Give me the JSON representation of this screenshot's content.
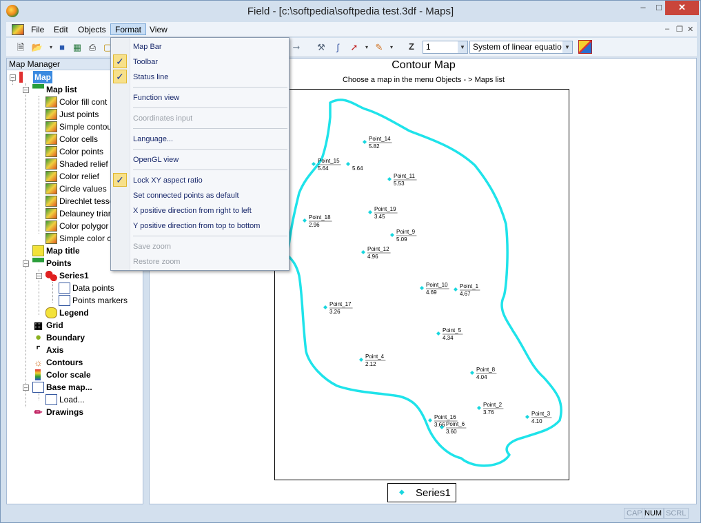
{
  "window": {
    "title": "Field - [c:\\softpedia\\softpedia test.3df - Maps]",
    "min_glyph": "–",
    "max_glyph": "□",
    "close_glyph": "✕"
  },
  "menubar": {
    "items": [
      "File",
      "Edit",
      "Objects",
      "Format",
      "View"
    ],
    "active": "Format",
    "mdi_min": "–",
    "mdi_restore": "❐",
    "mdi_close": "✕"
  },
  "toolbar": {
    "z_label": "Z",
    "z_value": "1",
    "solver_value": "System of linear equatio"
  },
  "format_menu": {
    "items": [
      {
        "label": "Map Bar",
        "checked": false,
        "disabled": false
      },
      {
        "label": "Toolbar",
        "checked": true,
        "disabled": false
      },
      {
        "label": "Status line",
        "checked": true,
        "disabled": false
      },
      {
        "label": "Function view",
        "checked": false,
        "disabled": false
      },
      {
        "label": "Coordinates input",
        "checked": false,
        "disabled": true
      },
      {
        "label": "Language...",
        "checked": false,
        "disabled": false
      },
      {
        "label": "OpenGL view",
        "checked": false,
        "disabled": false
      },
      {
        "label": "Lock XY aspect ratio",
        "checked": true,
        "disabled": false
      },
      {
        "label": "Set connected points as default",
        "checked": false,
        "disabled": false
      },
      {
        "label": "X positive direction from right to left",
        "checked": false,
        "disabled": false
      },
      {
        "label": "Y positive direction from top to bottom",
        "checked": false,
        "disabled": false
      },
      {
        "label": "Save zoom",
        "checked": false,
        "disabled": true
      },
      {
        "label": "Restore zoom",
        "checked": false,
        "disabled": true
      }
    ],
    "check_glyph": "✓"
  },
  "map_manager": {
    "header": "Map Manager",
    "tree": {
      "root": "Map",
      "map_list": "Map list",
      "map_list_items": [
        "Color fill cont",
        "Just points",
        "Simple contou",
        "Color cells",
        "Color points",
        "Shaded relief",
        "Color relief",
        "Circle values",
        "Direchlet tesse",
        "Delauney triar",
        "Color polygor",
        "Simple color c"
      ],
      "map_title": "Map title",
      "points": "Points",
      "series1": "Series1",
      "data_points": "Data points",
      "points_markers": "Points markers",
      "legend": "Legend",
      "grid": "Grid",
      "boundary": "Boundary",
      "axis": "Axis",
      "contours": "Contours",
      "color_scale": "Color scale",
      "base_map": "Base map...",
      "load": "Load...",
      "drawings": "Drawings"
    }
  },
  "map": {
    "title": "Contour Map",
    "subtitle": "Choose a map in the menu Objects - > Maps list",
    "legend_label": "Series1",
    "marker_color": "#17d6de",
    "boundary_color": "#1fe3ea",
    "points": [
      {
        "name": "Point_14",
        "value": "5.82"
      },
      {
        "name": "Point_15",
        "value": "5.64"
      },
      {
        "name": "",
        "value": "5.64"
      },
      {
        "name": "Point_11",
        "value": "5.53"
      },
      {
        "name": "Point_19",
        "value": "3.45"
      },
      {
        "name": "Point_18",
        "value": "2.96"
      },
      {
        "name": "Point_9",
        "value": "5.09"
      },
      {
        "name": "Point_12",
        "value": "4.96"
      },
      {
        "name": "Point_10",
        "value": "4.69"
      },
      {
        "name": "Point_1",
        "value": "4.67"
      },
      {
        "name": "Point_17",
        "value": "3.26"
      },
      {
        "name": "Point_5",
        "value": "4.34"
      },
      {
        "name": "Point_4",
        "value": "2.12"
      },
      {
        "name": "Point_8",
        "value": "4.04"
      },
      {
        "name": "Point_2",
        "value": "3.76"
      },
      {
        "name": "Point_3",
        "value": "4.10"
      },
      {
        "name": "Point_16",
        "value": "3.66"
      },
      {
        "name": "Point_6",
        "value": "3.60"
      }
    ]
  },
  "statusbar": {
    "cap": "CAP",
    "num": "NUM",
    "scrl": "SCRL"
  }
}
